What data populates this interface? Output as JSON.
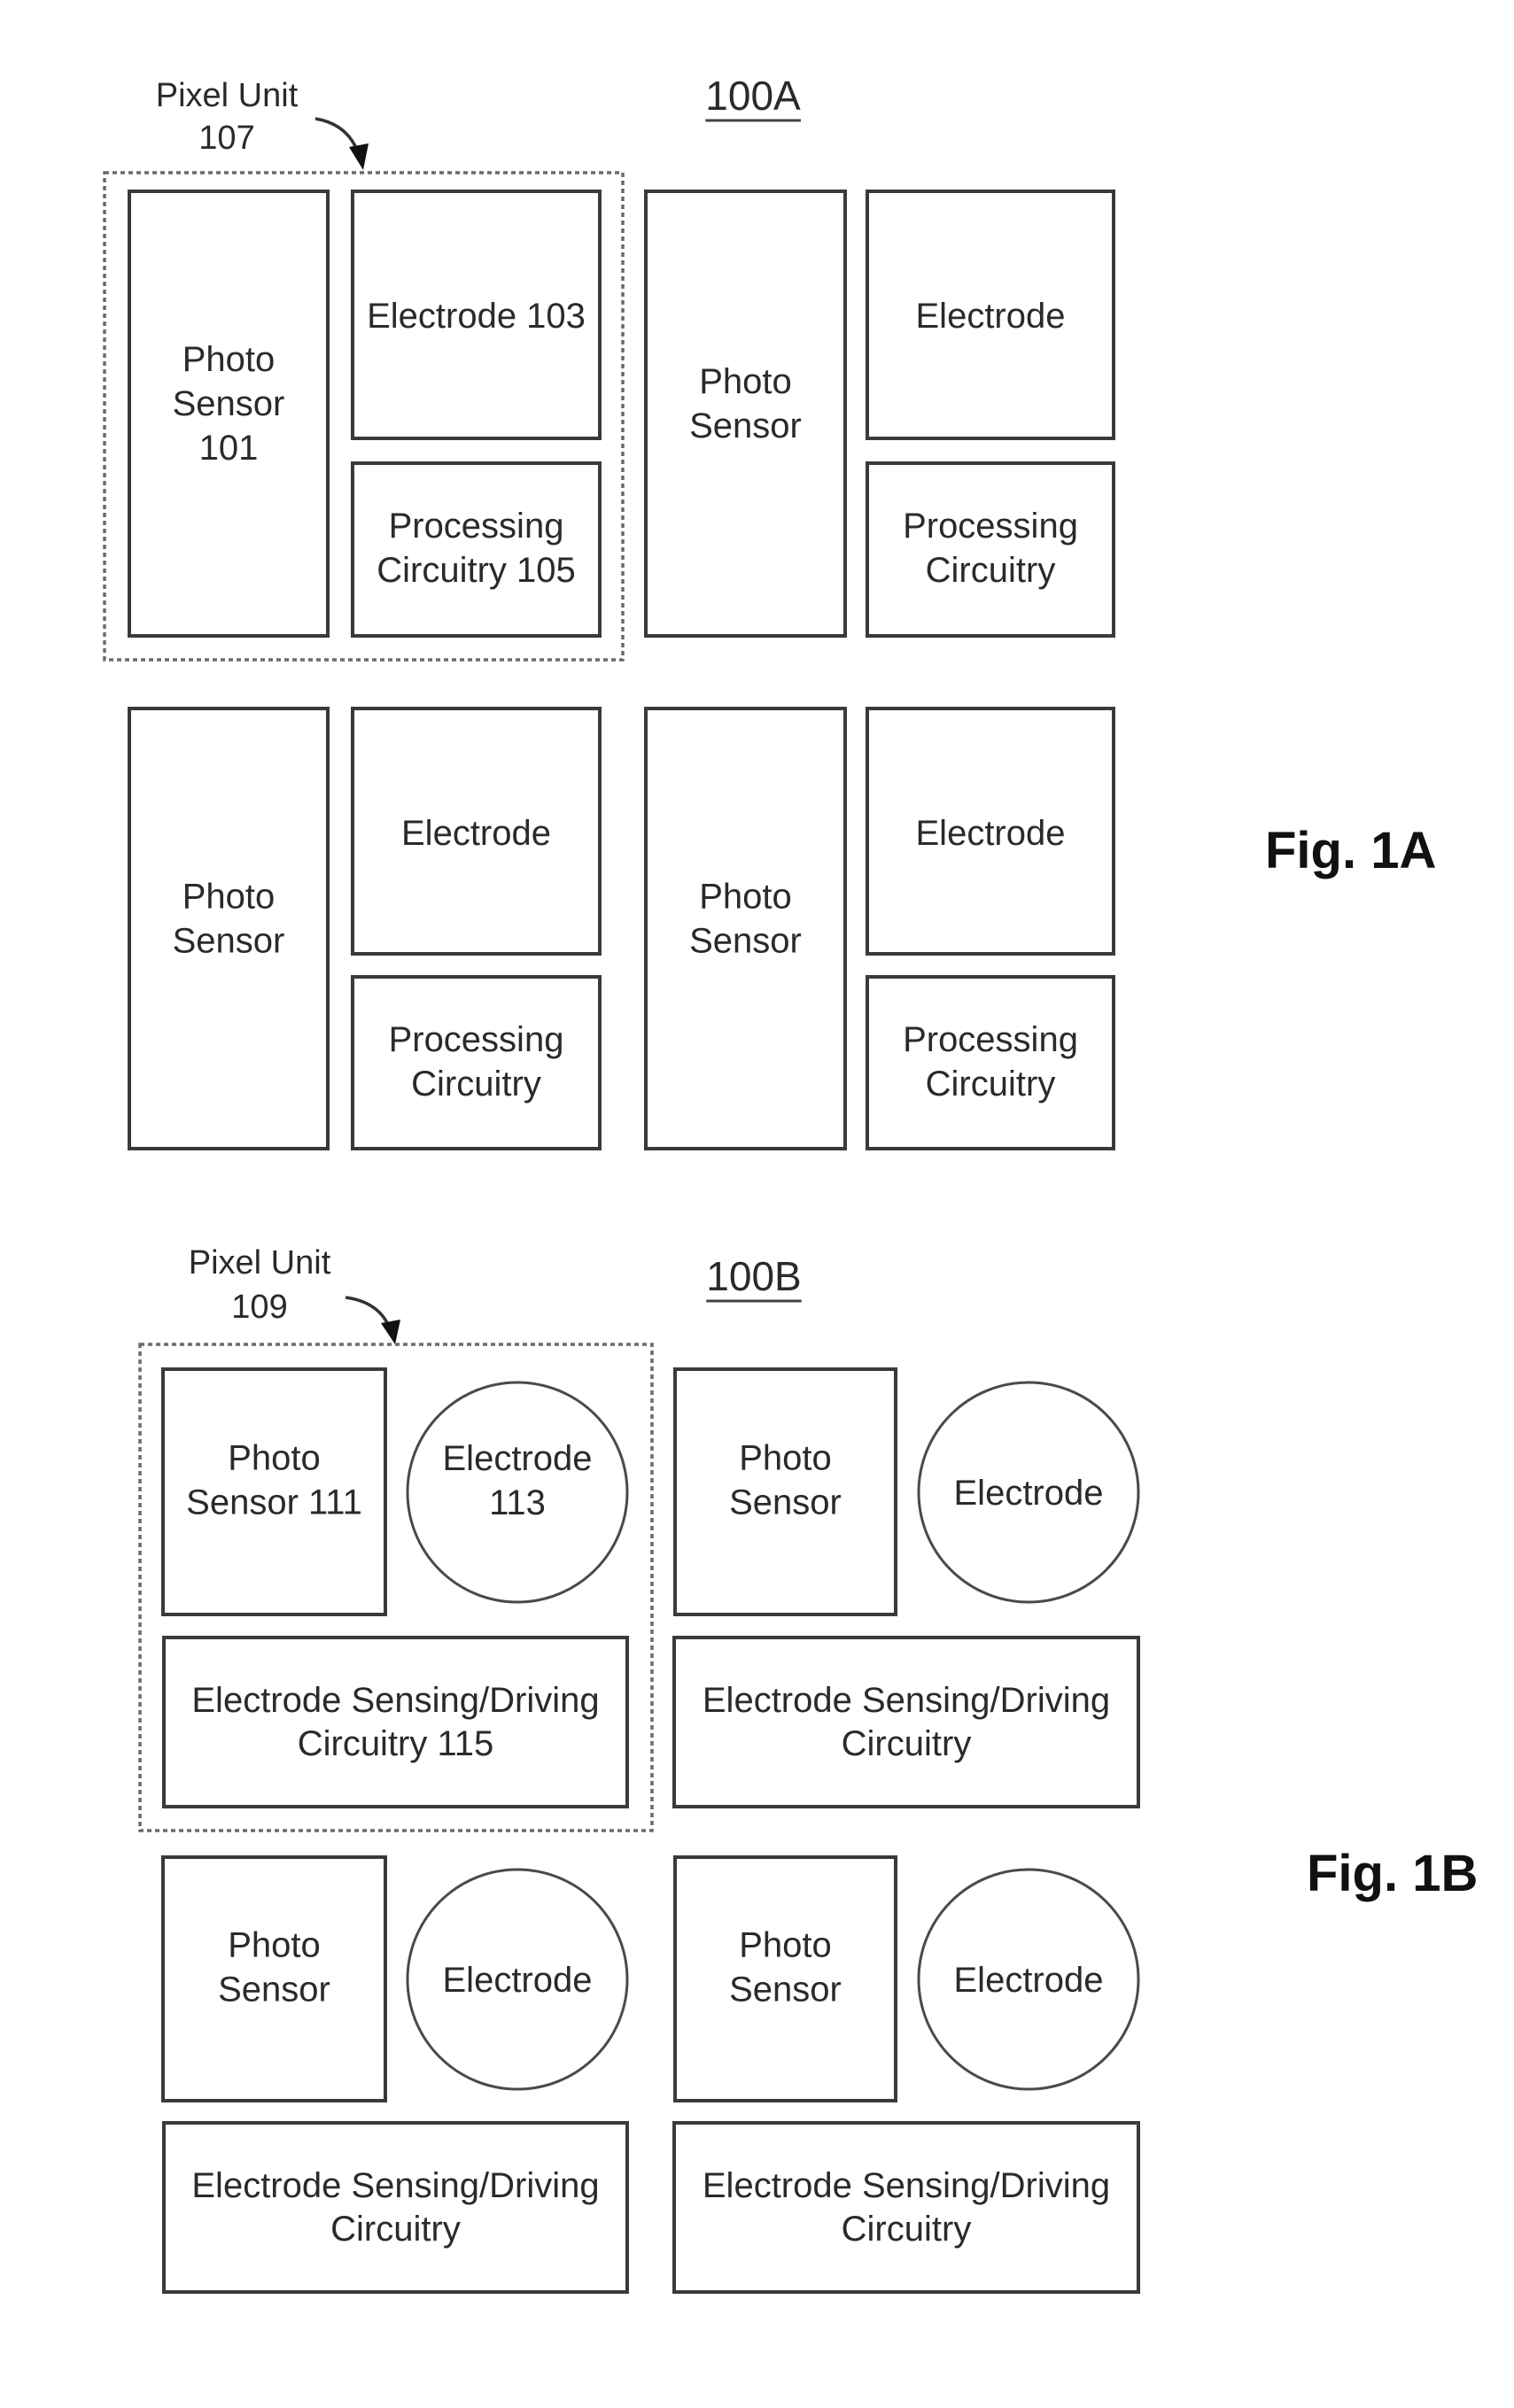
{
  "figure_1a": {
    "reference": "100A",
    "figure_label": "Fig. 1A",
    "pixel_unit_label": [
      "Pixel Unit",
      "107"
    ],
    "cells": [
      {
        "photo_sensor": [
          "Photo",
          "Sensor",
          "101"
        ],
        "electrode": [
          "Electrode 103"
        ],
        "processing": [
          "Processing",
          "Circuitry 105"
        ]
      },
      {
        "photo_sensor": [
          "Photo",
          "Sensor"
        ],
        "electrode": [
          "Electrode"
        ],
        "processing": [
          "Processing",
          "Circuitry"
        ]
      },
      {
        "photo_sensor": [
          "Photo",
          "Sensor"
        ],
        "electrode": [
          "Electrode"
        ],
        "processing": [
          "Processing",
          "Circuitry"
        ]
      },
      {
        "photo_sensor": [
          "Photo",
          "Sensor"
        ],
        "electrode": [
          "Electrode"
        ],
        "processing": [
          "Processing",
          "Circuitry"
        ]
      }
    ]
  },
  "figure_1b": {
    "reference": "100B",
    "figure_label": "Fig. 1B",
    "pixel_unit_label": [
      "Pixel Unit",
      "109"
    ],
    "cells": [
      {
        "photo_sensor": [
          "Photo",
          "Sensor 111"
        ],
        "electrode": [
          "Electrode",
          "113"
        ],
        "sensing": [
          "Electrode Sensing/Driving",
          "Circuitry 115"
        ]
      },
      {
        "photo_sensor": [
          "Photo",
          "Sensor"
        ],
        "electrode": [
          "Electrode"
        ],
        "sensing": [
          "Electrode Sensing/Driving",
          "Circuitry"
        ]
      },
      {
        "photo_sensor": [
          "Photo",
          "Sensor"
        ],
        "electrode": [
          "Electrode"
        ],
        "sensing": [
          "Electrode Sensing/Driving",
          "Circuitry"
        ]
      },
      {
        "photo_sensor": [
          "Photo",
          "Sensor"
        ],
        "electrode": [
          "Electrode"
        ],
        "sensing": [
          "Electrode Sensing/Driving",
          "Circuitry"
        ]
      }
    ]
  }
}
